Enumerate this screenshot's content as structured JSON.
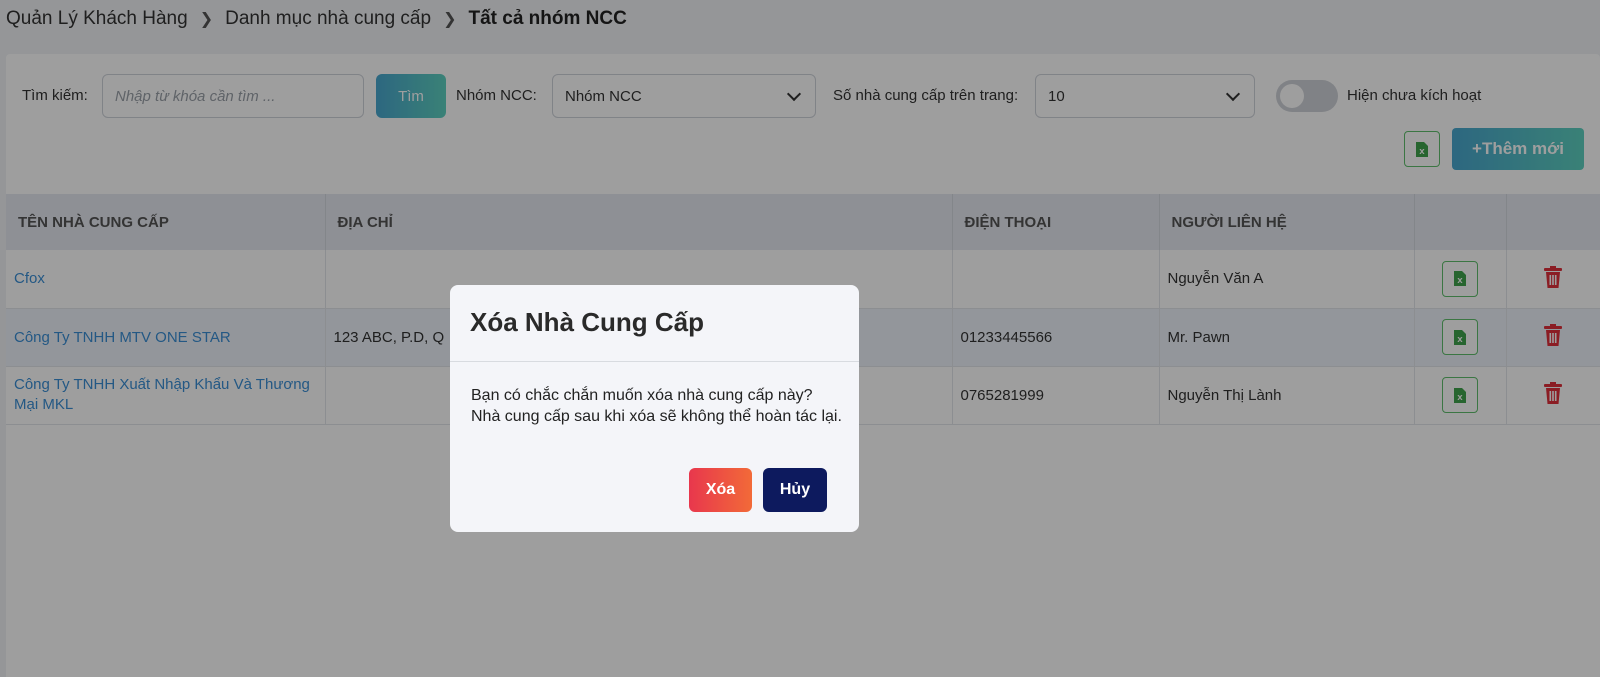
{
  "breadcrumb": {
    "items": [
      "Quản Lý Khách Hàng",
      "Danh mục nhà cung cấp"
    ],
    "current": "Tất cả nhóm NCC"
  },
  "toolbar": {
    "search_label": "Tìm kiếm:",
    "search_placeholder": "Nhập từ khóa cần tìm ...",
    "search_button": "Tìm",
    "group_label": "Nhóm NCC:",
    "group_value": "Nhóm NCC",
    "per_page_label": "Số nhà cung cấp trên trang:",
    "per_page_value": "10",
    "show_inactive_label": "Hiện chưa kích hoạt",
    "add_button": "+Thêm mới"
  },
  "table": {
    "columns": [
      "TÊN NHÀ CUNG CẤP",
      "ĐỊA CHỈ",
      "ĐIỆN THOẠI",
      "NGƯỜI LIÊN HỆ",
      "",
      ""
    ],
    "rows": [
      {
        "name": "Cfox",
        "address": "",
        "phone": "",
        "contact": "Nguyễn Văn A"
      },
      {
        "name": "Công Ty TNHH MTV ONE STAR",
        "address": "123 ABC, P.D, Q",
        "phone": "01233445566",
        "contact": "Mr. Pawn"
      },
      {
        "name": "Công Ty TNHH Xuất Nhập Khẩu Và Thương Mại MKL",
        "address": "",
        "phone": "0765281999",
        "contact": "Nguyễn Thị Lành"
      }
    ]
  },
  "modal": {
    "title": "Xóa Nhà Cung Cấp",
    "line1": "Bạn có chắc chắn muốn xóa nhà cung cấp này?",
    "line2": "Nhà cung cấp sau khi xóa sẽ không thể hoàn tác lại.",
    "delete_button": "Xóa",
    "cancel_button": "Hủy"
  },
  "colors": {
    "accent_gradient_start": "#49a7cf",
    "accent_gradient_end": "#5ed1c0",
    "link": "#3a8fd6",
    "excel_green": "#3fa34d",
    "trash_red": "#e0303a",
    "cancel_navy": "#0d1a5e"
  },
  "icons": {
    "breadcrumb_separator": "chevron-right-icon",
    "select_arrow": "chevron-down-icon",
    "excel": "excel-file-icon",
    "delete": "trash-icon"
  }
}
